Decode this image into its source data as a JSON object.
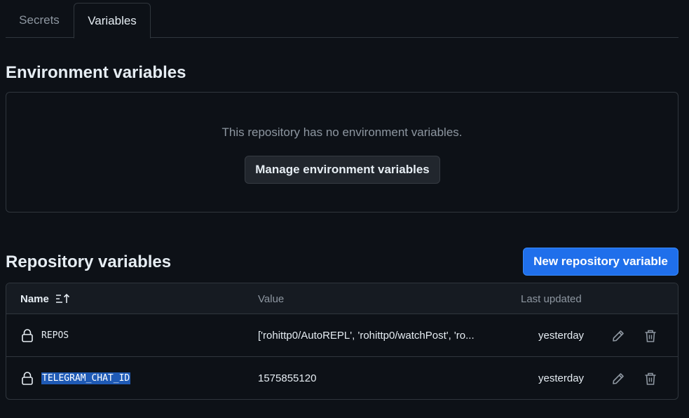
{
  "tabs": [
    {
      "label": "Secrets",
      "active": false
    },
    {
      "label": "Variables",
      "active": true
    }
  ],
  "environment": {
    "title": "Environment variables",
    "empty_message": "This repository has no environment variables.",
    "manage_button": "Manage environment variables"
  },
  "repository": {
    "title": "Repository variables",
    "new_button": "New repository variable",
    "columns": {
      "name": "Name",
      "value": "Value",
      "last_updated": "Last updated"
    },
    "rows": [
      {
        "name": "REPOS",
        "value": "['rohittp0/AutoREPL', 'rohittp0/watchPost', 'ro...",
        "updated": "yesterday",
        "selected": false
      },
      {
        "name": "TELEGRAM_CHAT_ID",
        "value": "1575855120",
        "updated": "yesterday",
        "selected": true
      }
    ]
  },
  "colors": {
    "background": "#0d1117",
    "border": "#30363d",
    "primary_button": "#1f6feb",
    "selection": "#1f5ab5",
    "muted_text": "#8d96a0"
  },
  "icons": [
    "sort-asc-icon",
    "lock-icon",
    "pencil-icon",
    "trash-icon"
  ]
}
